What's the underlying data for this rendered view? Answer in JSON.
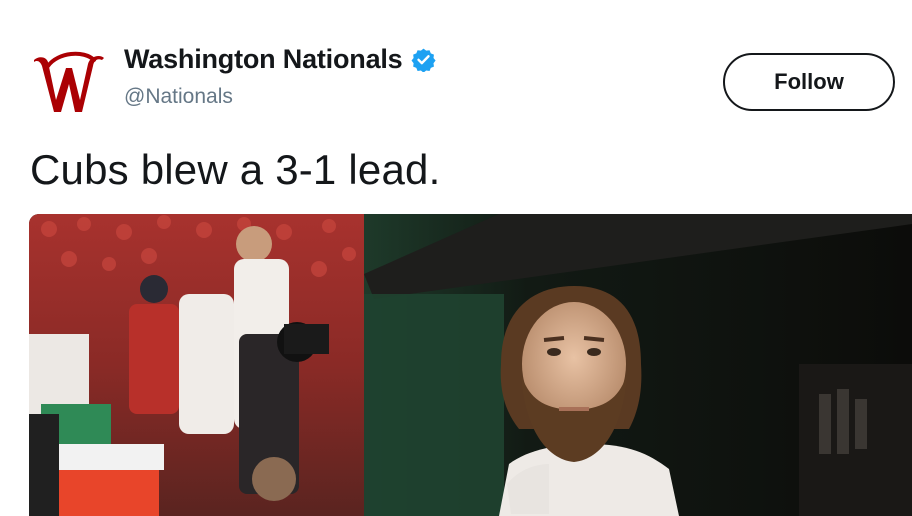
{
  "tweet": {
    "author": {
      "display_name": "Washington Nationals",
      "handle": "@Nationals",
      "verified": true,
      "avatar_icon": "nationals-w-logo-icon",
      "brand_color": "#ab0003"
    },
    "follow_label": "Follow",
    "text": "Cubs blew a 3-1 lead.",
    "media": {
      "type": "photo",
      "icon": "dugout-photo"
    }
  },
  "colors": {
    "text": "#14171a",
    "secondary": "#657786",
    "verified": "#1da1f2"
  }
}
